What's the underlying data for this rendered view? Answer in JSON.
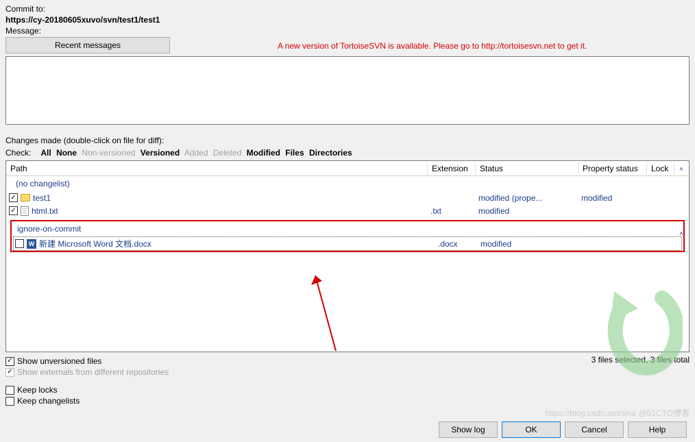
{
  "header": {
    "commit_to_label": "Commit to:",
    "url": "https://cy-20180605xuvo/svn/test1/test1",
    "message_label": "Message:",
    "recent_messages_btn": "Recent messages",
    "update_notice": "A new version of TortoiseSVN is available. Please go to http://tortoisesvn.net to get it."
  },
  "changes": {
    "label": "Changes made (double-click on file for diff):",
    "check_label": "Check:",
    "filters": {
      "all": "All",
      "none": "None",
      "nonversioned": "Non-versioned",
      "versioned": "Versioned",
      "added": "Added",
      "deleted": "Deleted",
      "modified": "Modified",
      "files": "Files",
      "directories": "Directories"
    },
    "columns": {
      "path": "Path",
      "ext": "Extension",
      "status": "Status",
      "prop": "Property status",
      "lock": "Lock"
    },
    "group_no_changelist": "(no changelist)",
    "group_ignore": "ignore-on-commit",
    "rows": {
      "r0": {
        "name": "test1",
        "ext": "",
        "status": "modified (prope...",
        "prop": "modified"
      },
      "r1": {
        "name": "html.txt",
        "ext": ".txt",
        "status": "modified",
        "prop": ""
      },
      "r2": {
        "name": "新建 Microsoft Word 文档.docx",
        "ext": ".docx",
        "status": "modified",
        "prop": ""
      }
    }
  },
  "footer": {
    "show_unversioned": "Show unversioned files",
    "show_externals": "Show externals from different repositories",
    "status_text": "3 files selected, 3 files total",
    "keep_locks": "Keep locks",
    "keep_changelists": "Keep changelists"
  },
  "buttons": {
    "showlog": "Show log",
    "ok": "OK",
    "cancel": "Cancel",
    "help": "Help"
  },
  "watermark": "https://blog.csdn.net/sina @51CTO博客"
}
